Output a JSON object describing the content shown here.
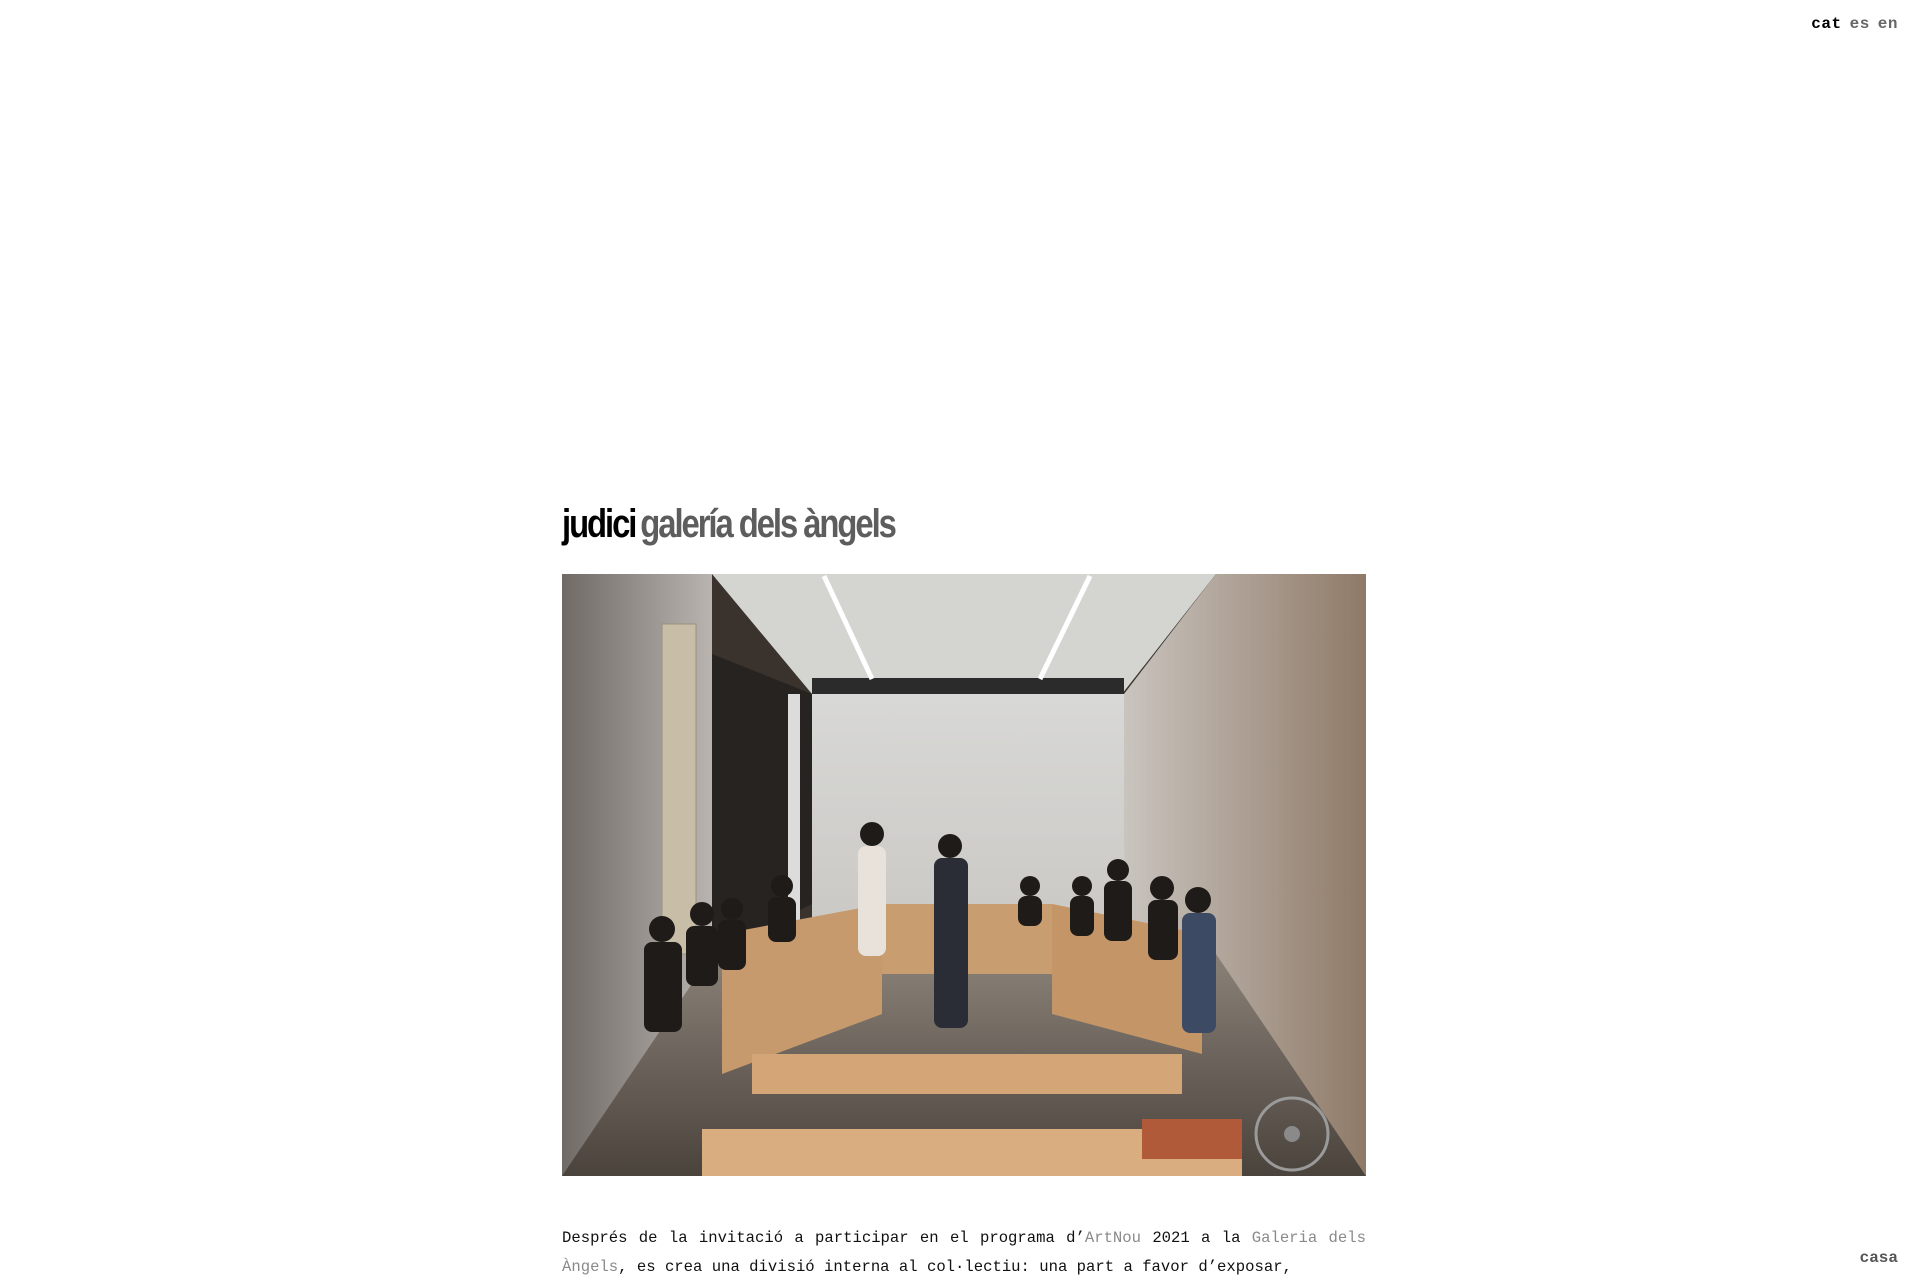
{
  "languages": [
    {
      "label": "cat",
      "active": true
    },
    {
      "label": "es",
      "active": false
    },
    {
      "label": "en",
      "active": false
    }
  ],
  "project": {
    "title_main": "judici",
    "title_sub": "galería dels àngels",
    "photo_alt": "judici galería dels àngels"
  },
  "description": {
    "part1": "Després de la invitació a participar en el programa d’",
    "link1": "ArtNou",
    "part2": " 2021 a la ",
    "link2": "Galeria dels Àngels",
    "part3": ", es crea una divisió interna al col·lectiu: una part a favor d’exposar,"
  },
  "footer": {
    "home_label": "casa"
  },
  "colors": {
    "text": "#111111",
    "muted": "#5d5d5d",
    "link": "#8a8a8a",
    "background": "#ffffff"
  }
}
